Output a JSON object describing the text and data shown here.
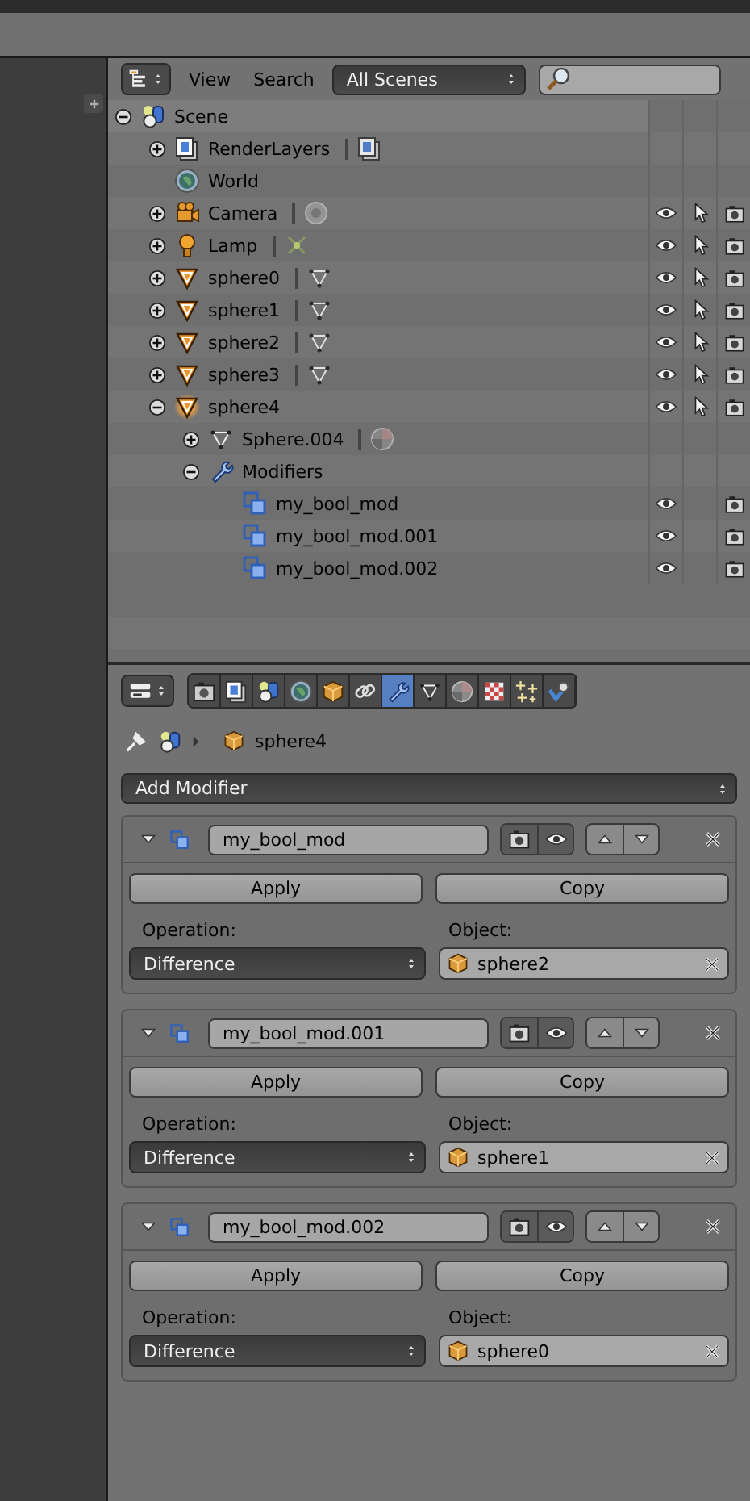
{
  "outliner": {
    "header": {
      "menus": [
        "View",
        "Search"
      ],
      "scene_filter": "All Scenes"
    },
    "tree": [
      {
        "name": "Scene",
        "kind": "scene",
        "expanded": true,
        "children": [
          {
            "name": "RenderLayers",
            "kind": "render_layers",
            "expanded": false,
            "link": {
              "kind": "render_layers"
            }
          },
          {
            "name": "World",
            "kind": "world"
          },
          {
            "name": "Camera",
            "kind": "camera",
            "expanded": false,
            "link": {
              "kind": "camera_data"
            },
            "visible": true,
            "selectable": true,
            "renderable": true
          },
          {
            "name": "Lamp",
            "kind": "lamp",
            "expanded": false,
            "link": {
              "kind": "lamp_data"
            },
            "visible": true,
            "selectable": true,
            "renderable": true
          },
          {
            "name": "sphere0",
            "kind": "mesh_object",
            "expanded": false,
            "link": {
              "kind": "mesh_data"
            },
            "visible": true,
            "selectable": true,
            "renderable": true
          },
          {
            "name": "sphere1",
            "kind": "mesh_object",
            "expanded": false,
            "link": {
              "kind": "mesh_data"
            },
            "visible": true,
            "selectable": true,
            "renderable": true
          },
          {
            "name": "sphere2",
            "kind": "mesh_object",
            "expanded": false,
            "link": {
              "kind": "mesh_data"
            },
            "visible": true,
            "selectable": true,
            "renderable": true
          },
          {
            "name": "sphere3",
            "kind": "mesh_object",
            "expanded": false,
            "link": {
              "kind": "mesh_data"
            },
            "visible": true,
            "selectable": true,
            "renderable": true
          },
          {
            "name": "sphere4",
            "kind": "mesh_object",
            "active": true,
            "expanded": true,
            "visible": true,
            "selectable": true,
            "renderable": true,
            "children": [
              {
                "name": "Sphere.004",
                "kind": "mesh_data",
                "expanded": false,
                "link": {
                  "kind": "material"
                }
              },
              {
                "name": "Modifiers",
                "kind": "wrench",
                "expanded": true,
                "children": [
                  {
                    "name": "my_bool_mod",
                    "kind": "boolean",
                    "visible": true,
                    "renderable": true
                  },
                  {
                    "name": "my_bool_mod.001",
                    "kind": "boolean",
                    "visible": true,
                    "renderable": true
                  },
                  {
                    "name": "my_bool_mod.002",
                    "kind": "boolean",
                    "visible": true,
                    "renderable": true
                  }
                ]
              }
            ]
          }
        ]
      }
    ]
  },
  "properties": {
    "tabs": [
      {
        "kind": "render",
        "selected": false
      },
      {
        "kind": "render_layers",
        "selected": false
      },
      {
        "kind": "scene",
        "selected": false
      },
      {
        "kind": "world",
        "selected": false
      },
      {
        "kind": "object",
        "selected": false
      },
      {
        "kind": "constraints",
        "selected": false
      },
      {
        "kind": "wrench",
        "selected": true
      },
      {
        "kind": "mesh_data",
        "selected": false
      },
      {
        "kind": "material",
        "selected": false
      },
      {
        "kind": "texture",
        "selected": false
      },
      {
        "kind": "particles",
        "selected": false
      },
      {
        "kind": "physics",
        "selected": false
      }
    ],
    "breadcrumb": "sphere4",
    "add_modifier": "Add Modifier",
    "modifiers": [
      {
        "name": "my_bool_mod",
        "expanded": true,
        "render": true,
        "viewport": true,
        "apply": "Apply",
        "copy": "Copy",
        "operation_label": "Operation:",
        "operation": "Difference",
        "object_label": "Object:",
        "object": "sphere2"
      },
      {
        "name": "my_bool_mod.001",
        "expanded": true,
        "render": true,
        "viewport": true,
        "apply": "Apply",
        "copy": "Copy",
        "operation_label": "Operation:",
        "operation": "Difference",
        "object_label": "Object:",
        "object": "sphere1"
      },
      {
        "name": "my_bool_mod.002",
        "expanded": true,
        "render": true,
        "viewport": true,
        "apply": "Apply",
        "copy": "Copy",
        "operation_label": "Operation:",
        "operation": "Difference",
        "object_label": "Object:",
        "object": "sphere0"
      }
    ]
  }
}
